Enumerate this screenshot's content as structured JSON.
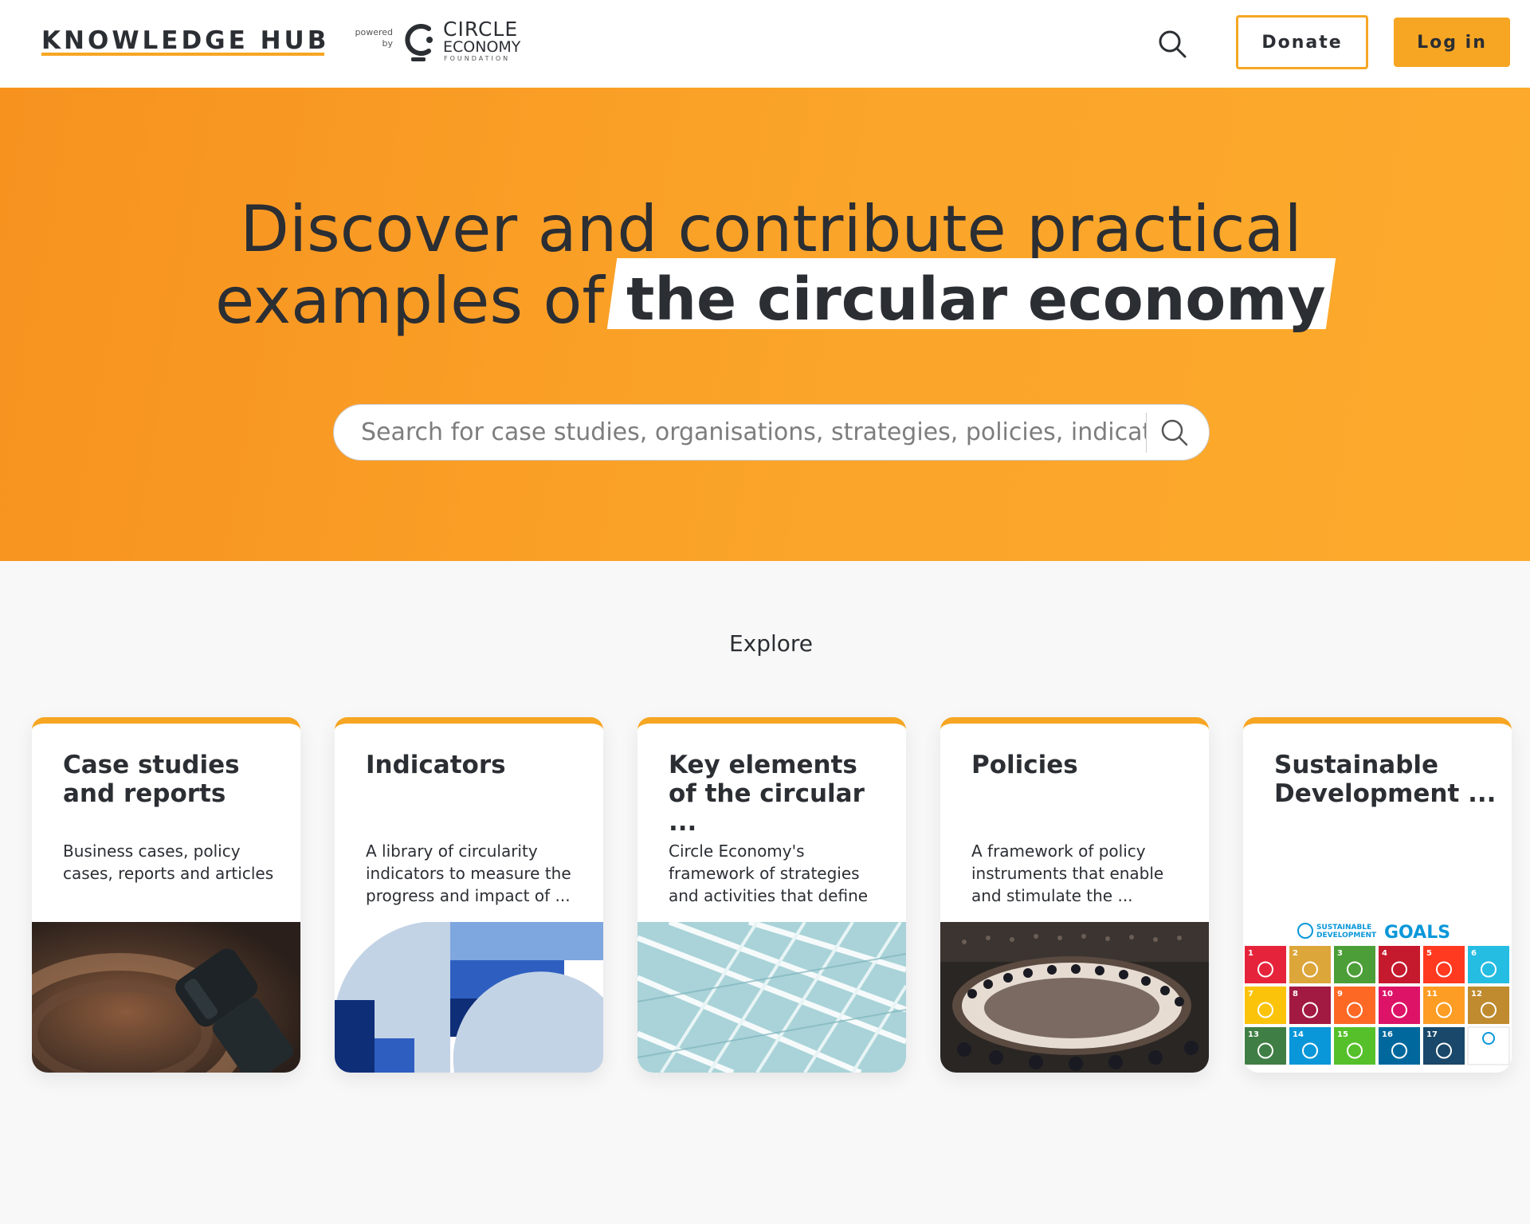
{
  "header": {
    "brand": "KNOWLEDGE HUB",
    "powered_line1": "powered",
    "powered_line2": "by",
    "partner_line1": "CIRCLE",
    "partner_line2": "ECONOMY",
    "partner_line3": "FOUNDATION",
    "donate_label": "Donate",
    "login_label": "Log in"
  },
  "hero": {
    "line1": "Discover and contribute practical",
    "line2_plain": "examples of",
    "line2_highlight": "the circular economy",
    "search_placeholder": "Search for case studies, organisations, strategies, policies, indicators..."
  },
  "explore": {
    "title": "Explore",
    "cards": [
      {
        "title": "Case studies and reports",
        "description": "Business cases, policy cases, reports and articles",
        "image": "binoculars-photo"
      },
      {
        "title": "Indicators",
        "description": "A library of circularity indicators to measure the progress and impact of ...",
        "image": "blue-geometric-illustration"
      },
      {
        "title": "Key elements of the circular ...",
        "description": "Circle Economy's framework of strategies and activities that define",
        "image": "white-architecture-photo"
      },
      {
        "title": "Policies",
        "description": "A framework of policy instruments that enable and stimulate the ...",
        "image": "un-council-photo"
      },
      {
        "title": "Sustainable Development ...",
        "description": "",
        "image": "sdg-goals-grid"
      }
    ],
    "sdg_header": "SUSTAINABLE DEVELOPMENT GOALS"
  },
  "colors": {
    "accent": "#f6a623",
    "hero_start": "#f7921f",
    "hero_end": "#fcaa2c",
    "text": "#2b2e33",
    "sdg": [
      "#e5243b",
      "#dda63a",
      "#4c9f38",
      "#c5192d",
      "#ff3a21",
      "#26bde2",
      "#fcc30b",
      "#a21942",
      "#fd6925",
      "#dd1367",
      "#fd9d24",
      "#bf8b2e",
      "#3f7e44",
      "#0a97d9",
      "#56c02b",
      "#00689d",
      "#19486a"
    ]
  }
}
